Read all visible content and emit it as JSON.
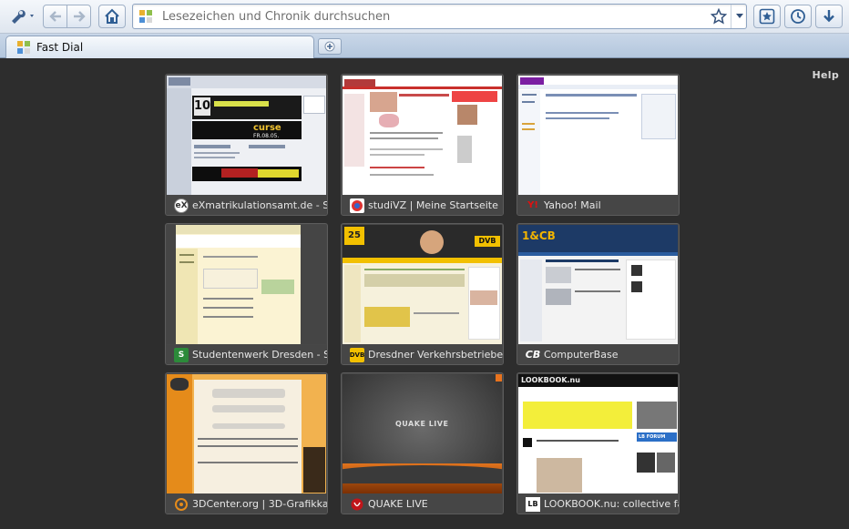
{
  "toolbar": {
    "url_placeholder": "Lesezeichen und Chronik durchsuchen",
    "url_value": ""
  },
  "tabs": [
    {
      "label": "Fast Dial",
      "icon": "fast-dial-icon",
      "active": true
    }
  ],
  "content": {
    "help_label": "Help",
    "background": "#2d2d2d"
  },
  "tiles": [
    {
      "title": "eXmatrikulationsamt.de - S",
      "icon": "exmatrikulationsamt-icon"
    },
    {
      "title": "studiVZ | Meine Startseite",
      "icon": "studivz-icon"
    },
    {
      "title": "Yahoo! Mail",
      "icon": "yahoo-icon",
      "icon_text": "Y!"
    },
    {
      "title": "Studentenwerk Dresden - S",
      "icon": "studentenwerk-icon"
    },
    {
      "title": "Dresdner Verkehrsbetriebe",
      "icon": "dvb-icon",
      "icon_text": "DVB"
    },
    {
      "title": "ComputerBase",
      "icon": "computerbase-icon",
      "icon_text": "CB"
    },
    {
      "title": "3DCenter.org | 3D-Grafikka",
      "icon": "3dcenter-icon"
    },
    {
      "title": "QUAKE LIVE",
      "icon": "quake-icon"
    },
    {
      "title": "LOOKBOOK.nu: collective fa",
      "icon": "lookbook-icon",
      "icon_text": "LB"
    }
  ],
  "thumbnails": {
    "t1": {
      "date": "FR.08.05.",
      "word": "curse"
    },
    "t5": {
      "badge": "25",
      "logo": "DVB"
    },
    "t6": {
      "logo": "1&CB"
    },
    "t8": {
      "logo": "QUAKE LIVE"
    },
    "t9": {
      "logo": "LOOKBOOK.nu",
      "forum": "LB FORUM"
    }
  }
}
